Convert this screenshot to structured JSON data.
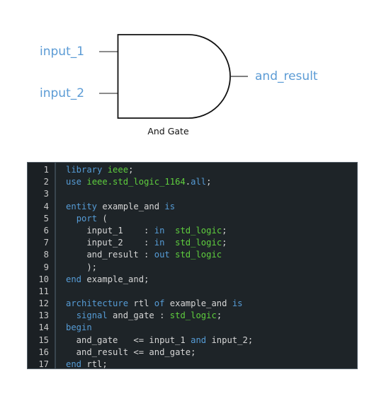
{
  "diagram": {
    "inputs": [
      "input_1",
      "input_2"
    ],
    "output": "and_result",
    "caption": "And Gate",
    "label_color": "#5b9bd5"
  },
  "code": {
    "language": "VHDL",
    "lines": [
      {
        "n": "1",
        "tokens": [
          [
            "kw",
            "library"
          ],
          [
            "id",
            " "
          ],
          [
            "ty",
            "ieee"
          ],
          [
            "id",
            ";"
          ]
        ]
      },
      {
        "n": "2",
        "tokens": [
          [
            "kw",
            "use"
          ],
          [
            "id",
            " "
          ],
          [
            "ty",
            "ieee.std_logic_1164"
          ],
          [
            "id",
            "."
          ],
          [
            "kw",
            "all"
          ],
          [
            "id",
            ";"
          ]
        ]
      },
      {
        "n": "3",
        "tokens": []
      },
      {
        "n": "4",
        "tokens": [
          [
            "kw",
            "entity"
          ],
          [
            "id",
            " example_and "
          ],
          [
            "kw",
            "is"
          ]
        ]
      },
      {
        "n": "5",
        "tokens": [
          [
            "id",
            "  "
          ],
          [
            "kw",
            "port"
          ],
          [
            "id",
            " ("
          ]
        ]
      },
      {
        "n": "6",
        "tokens": [
          [
            "id",
            "    input_1    : "
          ],
          [
            "kw",
            "in"
          ],
          [
            "id",
            "  "
          ],
          [
            "ty",
            "std_logic"
          ],
          [
            "id",
            ";"
          ]
        ]
      },
      {
        "n": "7",
        "tokens": [
          [
            "id",
            "    input_2    : "
          ],
          [
            "kw",
            "in"
          ],
          [
            "id",
            "  "
          ],
          [
            "ty",
            "std_logic"
          ],
          [
            "id",
            ";"
          ]
        ]
      },
      {
        "n": "8",
        "tokens": [
          [
            "id",
            "    and_result : "
          ],
          [
            "kw",
            "out"
          ],
          [
            "id",
            " "
          ],
          [
            "ty",
            "std_logic"
          ]
        ]
      },
      {
        "n": "9",
        "tokens": [
          [
            "id",
            "    );"
          ]
        ]
      },
      {
        "n": "10",
        "tokens": [
          [
            "kw",
            "end"
          ],
          [
            "id",
            " example_and;"
          ]
        ]
      },
      {
        "n": "11",
        "tokens": []
      },
      {
        "n": "12",
        "tokens": [
          [
            "kw",
            "architecture"
          ],
          [
            "id",
            " rtl "
          ],
          [
            "kw",
            "of"
          ],
          [
            "id",
            " example_and "
          ],
          [
            "kw",
            "is"
          ]
        ]
      },
      {
        "n": "13",
        "tokens": [
          [
            "id",
            "  "
          ],
          [
            "kw",
            "signal"
          ],
          [
            "id",
            " and_gate : "
          ],
          [
            "ty",
            "std_logic"
          ],
          [
            "id",
            ";"
          ]
        ]
      },
      {
        "n": "14",
        "tokens": [
          [
            "kw",
            "begin"
          ]
        ]
      },
      {
        "n": "15",
        "tokens": [
          [
            "id",
            "  and_gate   <= input_1 "
          ],
          [
            "kw",
            "and"
          ],
          [
            "id",
            " input_2;"
          ]
        ]
      },
      {
        "n": "16",
        "tokens": [
          [
            "id",
            "  and_result <= and_gate;"
          ]
        ]
      },
      {
        "n": "17",
        "tokens": [
          [
            "kw",
            "end"
          ],
          [
            "id",
            " rtl;"
          ]
        ]
      }
    ],
    "colors": {
      "background": "#1e2428",
      "keyword": "#569cd6",
      "type": "#5fce3e",
      "identifier": "#d6d6d6"
    }
  }
}
